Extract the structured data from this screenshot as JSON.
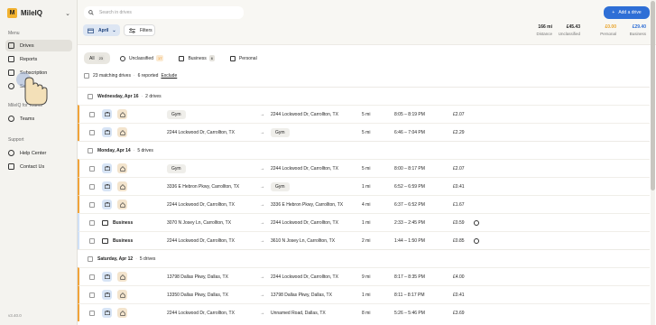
{
  "brand": {
    "name": "MileIQ",
    "logo_letter": "M"
  },
  "sidebar": {
    "menu_label": "Menu",
    "items": [
      {
        "label": "Drives",
        "icon": "car-icon",
        "active": true
      },
      {
        "label": "Reports",
        "icon": "report-icon"
      },
      {
        "label": "Subscription",
        "icon": "card-icon"
      },
      {
        "label": "Settings",
        "icon": "gear-icon"
      }
    ],
    "teams_label": "MileIQ for Teams",
    "teams_items": [
      {
        "label": "Teams",
        "icon": "team-icon"
      }
    ],
    "support_label": "Support",
    "support_items": [
      {
        "label": "Help Center",
        "icon": "help-icon"
      },
      {
        "label": "Contact Us",
        "icon": "chat-icon"
      }
    ],
    "version": "v3.40.0"
  },
  "header": {
    "search_placeholder": "Search in drives",
    "add_drive": "Add a drive",
    "date_filter": "April",
    "filters": "Filters",
    "stats": [
      {
        "value": "166 mi",
        "label": "Distance",
        "color": "#1f1f1f"
      },
      {
        "value": "£45.43",
        "label": "Unclassified",
        "color": "#1f1f1f"
      },
      {
        "value": "£0.00",
        "label": "Personal",
        "color": "#e8a32a"
      },
      {
        "value": "£29.40",
        "label": "Business",
        "color": "#2f6fd6"
      }
    ]
  },
  "tabs": [
    {
      "label": "All",
      "count": "23"
    },
    {
      "label": "Unclassified",
      "count": "17"
    },
    {
      "label": "Business",
      "count": "6"
    },
    {
      "label": "Personal",
      "count": ""
    }
  ],
  "matching": {
    "text": "23 matching drives",
    "reported": "6 reported",
    "exclude": "Exclude"
  },
  "groups": [
    {
      "date": "Wednesday, Apr 16",
      "count": "2 drives",
      "rows": [
        {
          "type": "unclassified",
          "from": "Gym",
          "from_pill": true,
          "to": "2244 Lockwood Dr, Carrollton, TX",
          "to_pill": false,
          "dist": "5 mi",
          "time": "8:05 – 8:19 PM",
          "value": "£2.07"
        },
        {
          "type": "unclassified",
          "from": "2244 Lockwood Dr, Carrollton, TX",
          "from_pill": false,
          "to": "Gym",
          "to_pill": true,
          "dist": "5 mi",
          "time": "6:46 – 7:04 PM",
          "value": "£2.29"
        }
      ]
    },
    {
      "date": "Monday, Apr 14",
      "count": "5 drives",
      "rows": [
        {
          "type": "unclassified",
          "from": "Gym",
          "from_pill": true,
          "to": "2244 Lockwood Dr, Carrollton, TX",
          "to_pill": false,
          "dist": "5 mi",
          "time": "8:00 – 8:17 PM",
          "value": "£2.07"
        },
        {
          "type": "unclassified",
          "from": "3336 E Hebron Pkwy, Carrollton, TX",
          "from_pill": false,
          "to": "Gym",
          "to_pill": true,
          "dist": "1 mi",
          "time": "6:52 – 6:59 PM",
          "value": "£0.41"
        },
        {
          "type": "unclassified",
          "from": "2244 Lockwood Dr, Carrollton, TX",
          "from_pill": false,
          "to": "3336 E Hebron Pkwy, Carrollton, TX",
          "to_pill": false,
          "dist": "4 mi",
          "time": "6:37 – 6:52 PM",
          "value": "£1.67"
        },
        {
          "type": "business",
          "label": "Business",
          "from": "3070 N Josey Ln, Carrollton, TX",
          "from_pill": false,
          "to": "2244 Lockwood Dr, Carrollton, TX",
          "to_pill": false,
          "dist": "1 mi",
          "time": "2:33 – 2:45 PM",
          "value": "£0.59"
        },
        {
          "type": "business",
          "label": "Business",
          "from": "2244 Lockwood Dr, Carrollton, TX",
          "from_pill": false,
          "to": "3610 N Josey Ln, Carrollton, TX",
          "to_pill": false,
          "dist": "2 mi",
          "time": "1:44 – 1:50 PM",
          "value": "£0.85"
        }
      ]
    },
    {
      "date": "Saturday, Apr 12",
      "count": "5 drives",
      "rows": [
        {
          "type": "unclassified",
          "from": "13798 Dallas Pkwy, Dallas, TX",
          "from_pill": false,
          "to": "2244 Lockwood Dr, Carrollton, TX",
          "to_pill": false,
          "dist": "9 mi",
          "time": "8:17 – 8:35 PM",
          "value": "£4.00"
        },
        {
          "type": "unclassified",
          "from": "13350 Dallas Pkwy, Dallas, TX",
          "from_pill": false,
          "to": "13798 Dallas Pkwy, Dallas, TX",
          "to_pill": false,
          "dist": "1 mi",
          "time": "8:11 – 8:17 PM",
          "value": "£0.41"
        },
        {
          "type": "unclassified",
          "from": "2244 Lockwood Dr, Carrollton, TX",
          "from_pill": false,
          "to": "Unnamed Road, Dallas, TX",
          "to_pill": false,
          "dist": "8 mi",
          "time": "5:26 – 5:46 PM",
          "value": "£3.69"
        }
      ]
    }
  ]
}
